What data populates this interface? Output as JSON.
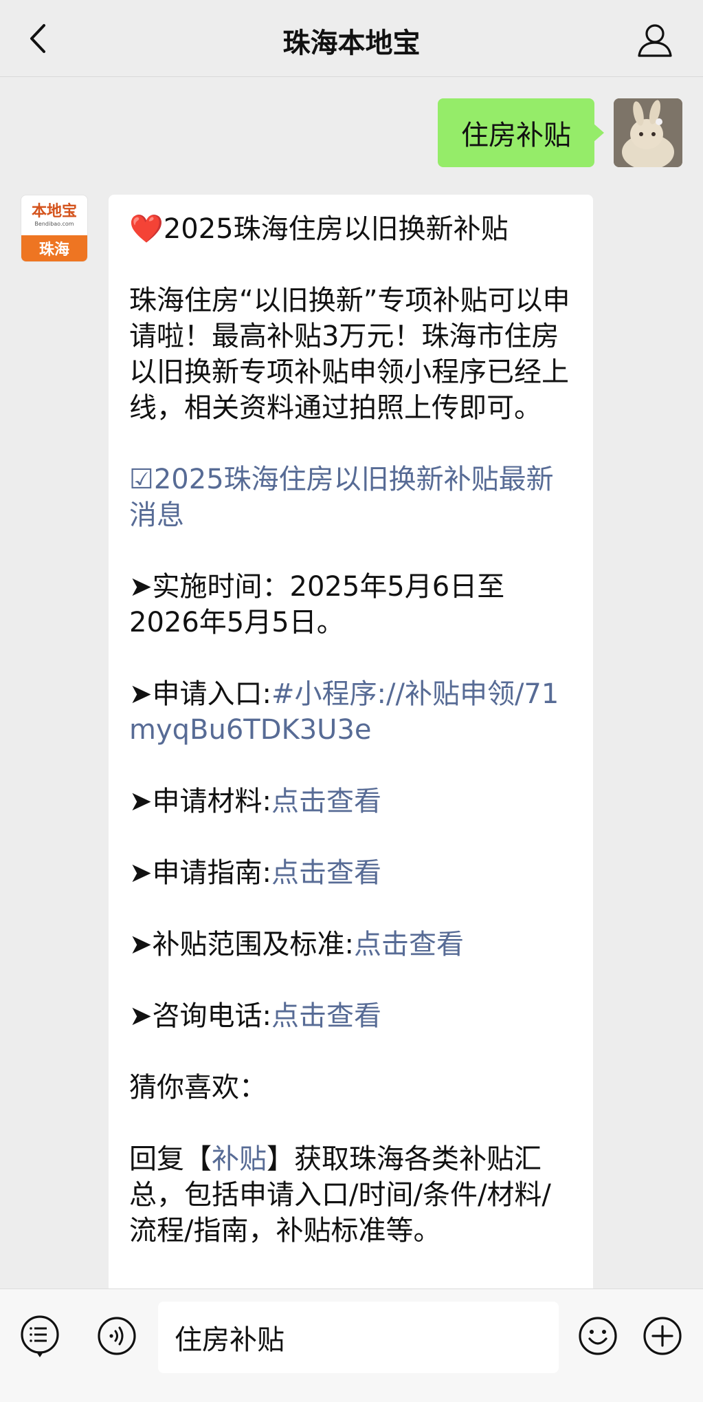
{
  "header": {
    "title": "珠海本地宝",
    "back_icon": "chevron-left-icon",
    "profile_icon": "person-icon"
  },
  "user_message": {
    "text": "住房补贴"
  },
  "bot_avatar": {
    "brand": "本地宝",
    "domain": "Bendibao.com",
    "city": "珠海"
  },
  "reply": {
    "heart": "❤️",
    "title": "2025珠海住房以旧换新补贴",
    "intro": "珠海住房“以旧换新”专项补贴可以申请啦！最高补贴3万元！珠海市住房以旧换新专项补贴申领小程序已经上线，相关资料通过拍照上传即可。",
    "news_link": "☑2025珠海住房以旧换新补贴最新消息",
    "time_label": "➤实施时间：",
    "time_value": "2025年5月6日至2026年5月5日。",
    "entry_label": "➤申请入口:",
    "entry_link": "#小程序://补贴申领/71myqBu6TDK3U3e",
    "materials_label": "➤申请材料:",
    "materials_link": "点击查看",
    "guide_label": "➤申请指南:",
    "guide_link": "点击查看",
    "scope_label": "➤补贴范围及标准:",
    "scope_link": "点击查看",
    "phone_label": "➤咨询电话:",
    "phone_link": "点击查看",
    "guess": "猜你喜欢：",
    "reply_prefix": "回复【",
    "reply_keyword": "补贴",
    "reply_suffix": "】获取珠海各类补贴汇总，包括申请入口/时间/条件/材料/流程/指南，补贴标准等。"
  },
  "input_bar": {
    "menu_icon": "menu-list-icon",
    "voice_icon": "voice-icon",
    "text": "住房补贴",
    "emoji_icon": "emoji-icon",
    "plus_icon": "plus-icon"
  },
  "colors": {
    "green_bubble": "#95ec69",
    "link": "#576b95",
    "background": "#ededed"
  }
}
